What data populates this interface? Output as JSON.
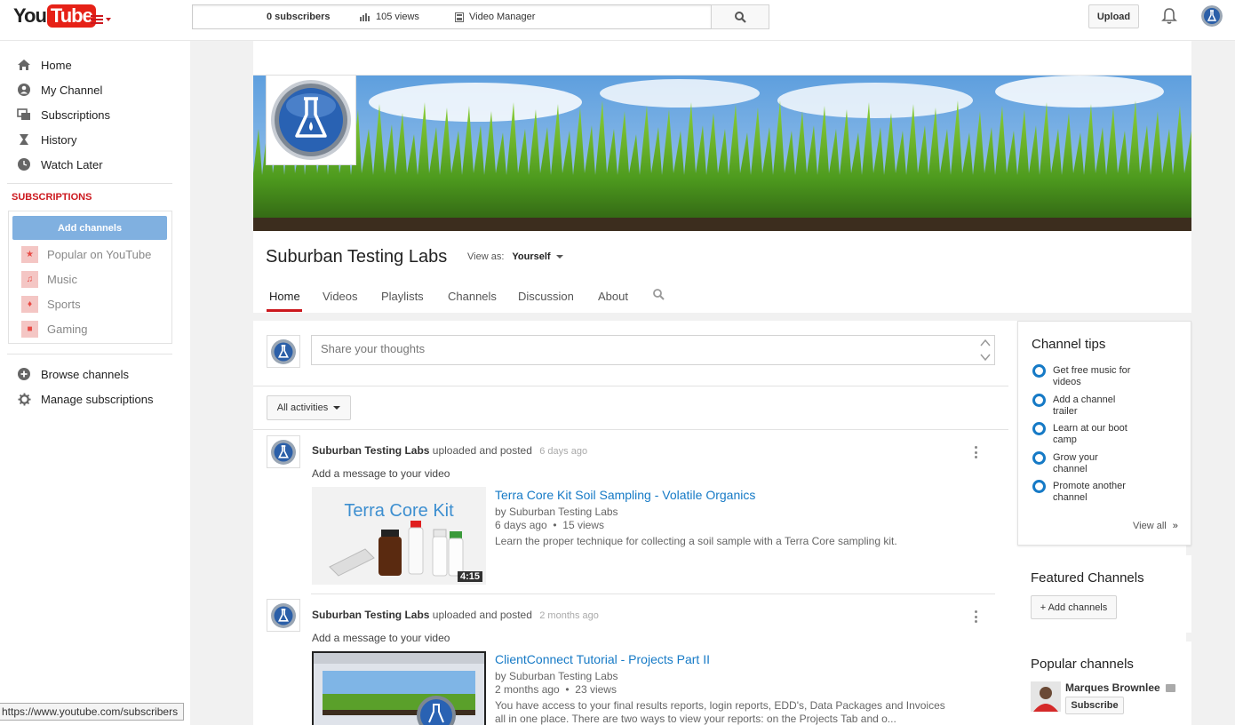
{
  "header": {
    "logo_you": "You",
    "logo_tube": "Tube",
    "search_value": "",
    "upload_label": "Upload"
  },
  "guide": {
    "nav": [
      {
        "label": "Home",
        "icon": "home-icon"
      },
      {
        "label": "My Channel",
        "icon": "person-icon"
      },
      {
        "label": "Subscriptions",
        "icon": "subscriptions-icon"
      },
      {
        "label": "History",
        "icon": "hourglass-icon"
      },
      {
        "label": "Watch Later",
        "icon": "clock-icon"
      }
    ],
    "subscriptions_heading": "SUBSCRIPTIONS",
    "add_channels_label": "Add channels",
    "subscriptions": [
      {
        "label": "Popular on YouTube",
        "icon": "star-icon"
      },
      {
        "label": "Music",
        "icon": "headphones-icon"
      },
      {
        "label": "Sports",
        "icon": "trophy-icon"
      },
      {
        "label": "Gaming",
        "icon": "gamepad-icon"
      }
    ],
    "bottom": [
      {
        "label": "Browse channels",
        "icon": "plus-circle-icon"
      },
      {
        "label": "Manage subscriptions",
        "icon": "gear-icon"
      }
    ],
    "status_url": "https://www.youtube.com/subscribers"
  },
  "stats": {
    "subscribers": "0 subscribers",
    "views": "105 views",
    "video_manager": "Video Manager"
  },
  "channel": {
    "title": "Suburban Testing Labs",
    "view_as_label": "View as:",
    "view_as_value": "Yourself",
    "tabs": [
      "Home",
      "Videos",
      "Playlists",
      "Channels",
      "Discussion",
      "About"
    ],
    "active_tab": "Home"
  },
  "feed": {
    "share_placeholder": "Share your thoughts",
    "filter_label": "All activities",
    "posts": [
      {
        "author": "Suburban Testing Labs",
        "action": "uploaded and posted",
        "time": "6 days ago",
        "message": "Add a message to your video",
        "thumb_text": "Terra Core Kit",
        "duration": "4:15",
        "video_title": "Terra Core Kit Soil Sampling - Volatile Organics",
        "by": "by Suburban Testing Labs",
        "age": "6 days ago",
        "views": "15 views",
        "description": "Learn the proper technique for collecting a soil sample with a Terra Core sampling kit."
      },
      {
        "author": "Suburban Testing Labs",
        "action": "uploaded and posted",
        "time": "2 months ago",
        "message": "Add a message to your video",
        "thumb_text": "",
        "duration": "",
        "video_title": "ClientConnect Tutorial - Projects Part II",
        "by": "by Suburban Testing Labs",
        "age": "2 months ago",
        "views": "23 views",
        "description": "You have access to your final results reports, login reports, EDD's, Data Packages and Invoices all in one place. There are two ways to view your reports: on the Projects Tab and o..."
      }
    ]
  },
  "sidebar_right": {
    "tips_title": "Channel tips",
    "tips": [
      "Get free music for videos",
      "Add a channel trailer",
      "Learn at our boot camp",
      "Grow your channel",
      "Promote another channel"
    ],
    "view_all": "View all",
    "featured_title": "Featured Channels",
    "add_featured_label": "+ Add channels",
    "popular_title": "Popular channels",
    "popular_name": "Marques Brownlee",
    "subscribe_label": "Subscribe"
  },
  "colors": {
    "brand_red": "#cc181e",
    "link_blue": "#167ac6",
    "add_channels_blue": "#80b0e0"
  }
}
